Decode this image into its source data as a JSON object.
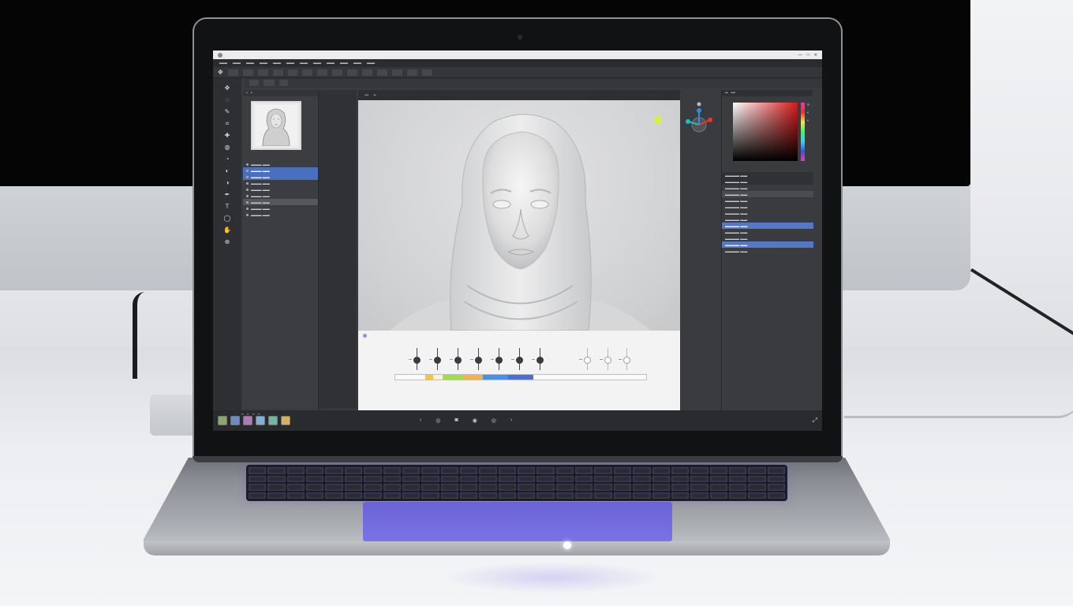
{
  "scene": {
    "description_colors": {
      "desk": "#e6e7ea",
      "keyboard_glow": "#6a63d6",
      "monitor_screen": "#050506"
    }
  },
  "app": {
    "titlebar": {
      "controls": [
        "—",
        "□",
        "✕"
      ]
    },
    "menubar": {
      "items": [
        "",
        "",
        "",
        "",
        "",
        "",
        "",
        "",
        "",
        "",
        "",
        ""
      ]
    },
    "options_chips": [
      "",
      "",
      "",
      "",
      "",
      "",
      "",
      "",
      "",
      "",
      "",
      "",
      "",
      ""
    ],
    "layers": {
      "rows": [
        {
          "label": "",
          "count": "",
          "state": "normal"
        },
        {
          "label": "",
          "count": "",
          "state": "selected"
        },
        {
          "label": "",
          "count": "",
          "state": "selected"
        },
        {
          "label": "",
          "count": "",
          "state": "normal"
        },
        {
          "label": "",
          "count": "",
          "state": "normal"
        },
        {
          "label": "",
          "count": "",
          "state": "normal"
        },
        {
          "label": "",
          "count": "",
          "state": "gray"
        },
        {
          "label": "",
          "count": "",
          "state": "normal"
        },
        {
          "label": "",
          "count": "",
          "state": "normal"
        }
      ]
    },
    "timeline": {
      "title": "",
      "segment_colors": [
        "#fafafa",
        "#f4c542",
        "#f8f3d0",
        "#9fdc4a",
        "#f2b24e",
        "#4a8ee8",
        "#4b6fd6",
        "#fafafa"
      ]
    },
    "properties": {
      "rows": [
        {
          "label": "",
          "state": "head"
        },
        {
          "label": "",
          "state": "head"
        },
        {
          "label": "",
          "state": "normal"
        },
        {
          "label": "",
          "state": "gray"
        },
        {
          "label": "",
          "state": "normal"
        },
        {
          "label": "",
          "state": "normal"
        },
        {
          "label": "",
          "state": "normal"
        },
        {
          "label": "",
          "state": "normal"
        },
        {
          "label": "",
          "state": "selected"
        },
        {
          "label": "",
          "state": "normal"
        },
        {
          "label": "",
          "state": "normal"
        },
        {
          "label": "",
          "state": "selected"
        },
        {
          "label": "",
          "state": "normal"
        }
      ]
    },
    "icons": {
      "tools": [
        "move-tool-icon",
        "lasso-icon",
        "brush-icon",
        "crop-icon",
        "eyedropper-icon",
        "healing-icon",
        "stamp-icon",
        "eraser-icon",
        "gradient-icon",
        "pen-icon",
        "text-icon",
        "shape-icon",
        "hand-icon",
        "zoom-icon"
      ]
    }
  }
}
